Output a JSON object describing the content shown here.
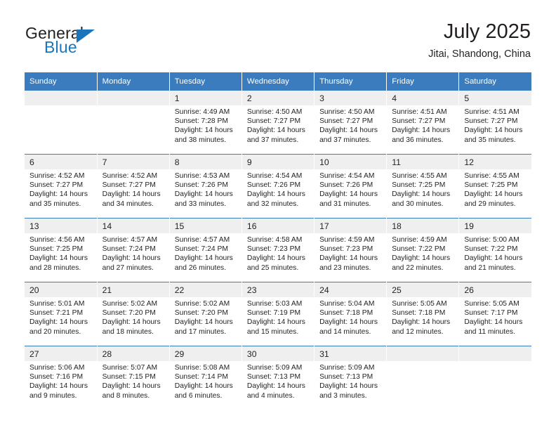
{
  "brand": {
    "logo_top": "General",
    "logo_bottom": "Blue",
    "accent_color": "#1b75bb",
    "triangle_icon": "blue-triangle-icon"
  },
  "header": {
    "title": "July 2025",
    "subtitle": "Jitai, Shandong, China"
  },
  "colors": {
    "header_row_bg": "#3a7cbe",
    "header_row_text": "#ffffff",
    "daynum_bg": "#efefef",
    "cell_bg": "#ffffff",
    "row_divider": "#3a7cbe",
    "body_text": "#231f20"
  },
  "calendar": {
    "weekday_headers": [
      "Sunday",
      "Monday",
      "Tuesday",
      "Wednesday",
      "Thursday",
      "Friday",
      "Saturday"
    ],
    "labels": {
      "sunrise_prefix": "Sunrise:",
      "sunset_prefix": "Sunset:",
      "daylight_prefix": "Daylight:"
    },
    "weeks": [
      [
        {
          "day": "",
          "lines": []
        },
        {
          "day": "",
          "lines": []
        },
        {
          "day": "1",
          "lines": [
            "Sunrise: 4:49 AM",
            "Sunset: 7:28 PM",
            "Daylight: 14 hours",
            "and 38 minutes."
          ]
        },
        {
          "day": "2",
          "lines": [
            "Sunrise: 4:50 AM",
            "Sunset: 7:27 PM",
            "Daylight: 14 hours",
            "and 37 minutes."
          ]
        },
        {
          "day": "3",
          "lines": [
            "Sunrise: 4:50 AM",
            "Sunset: 7:27 PM",
            "Daylight: 14 hours",
            "and 37 minutes."
          ]
        },
        {
          "day": "4",
          "lines": [
            "Sunrise: 4:51 AM",
            "Sunset: 7:27 PM",
            "Daylight: 14 hours",
            "and 36 minutes."
          ]
        },
        {
          "day": "5",
          "lines": [
            "Sunrise: 4:51 AM",
            "Sunset: 7:27 PM",
            "Daylight: 14 hours",
            "and 35 minutes."
          ]
        }
      ],
      [
        {
          "day": "6",
          "lines": [
            "Sunrise: 4:52 AM",
            "Sunset: 7:27 PM",
            "Daylight: 14 hours",
            "and 35 minutes."
          ]
        },
        {
          "day": "7",
          "lines": [
            "Sunrise: 4:52 AM",
            "Sunset: 7:27 PM",
            "Daylight: 14 hours",
            "and 34 minutes."
          ]
        },
        {
          "day": "8",
          "lines": [
            "Sunrise: 4:53 AM",
            "Sunset: 7:26 PM",
            "Daylight: 14 hours",
            "and 33 minutes."
          ]
        },
        {
          "day": "9",
          "lines": [
            "Sunrise: 4:54 AM",
            "Sunset: 7:26 PM",
            "Daylight: 14 hours",
            "and 32 minutes."
          ]
        },
        {
          "day": "10",
          "lines": [
            "Sunrise: 4:54 AM",
            "Sunset: 7:26 PM",
            "Daylight: 14 hours",
            "and 31 minutes."
          ]
        },
        {
          "day": "11",
          "lines": [
            "Sunrise: 4:55 AM",
            "Sunset: 7:25 PM",
            "Daylight: 14 hours",
            "and 30 minutes."
          ]
        },
        {
          "day": "12",
          "lines": [
            "Sunrise: 4:55 AM",
            "Sunset: 7:25 PM",
            "Daylight: 14 hours",
            "and 29 minutes."
          ]
        }
      ],
      [
        {
          "day": "13",
          "lines": [
            "Sunrise: 4:56 AM",
            "Sunset: 7:25 PM",
            "Daylight: 14 hours",
            "and 28 minutes."
          ]
        },
        {
          "day": "14",
          "lines": [
            "Sunrise: 4:57 AM",
            "Sunset: 7:24 PM",
            "Daylight: 14 hours",
            "and 27 minutes."
          ]
        },
        {
          "day": "15",
          "lines": [
            "Sunrise: 4:57 AM",
            "Sunset: 7:24 PM",
            "Daylight: 14 hours",
            "and 26 minutes."
          ]
        },
        {
          "day": "16",
          "lines": [
            "Sunrise: 4:58 AM",
            "Sunset: 7:23 PM",
            "Daylight: 14 hours",
            "and 25 minutes."
          ]
        },
        {
          "day": "17",
          "lines": [
            "Sunrise: 4:59 AM",
            "Sunset: 7:23 PM",
            "Daylight: 14 hours",
            "and 23 minutes."
          ]
        },
        {
          "day": "18",
          "lines": [
            "Sunrise: 4:59 AM",
            "Sunset: 7:22 PM",
            "Daylight: 14 hours",
            "and 22 minutes."
          ]
        },
        {
          "day": "19",
          "lines": [
            "Sunrise: 5:00 AM",
            "Sunset: 7:22 PM",
            "Daylight: 14 hours",
            "and 21 minutes."
          ]
        }
      ],
      [
        {
          "day": "20",
          "lines": [
            "Sunrise: 5:01 AM",
            "Sunset: 7:21 PM",
            "Daylight: 14 hours",
            "and 20 minutes."
          ]
        },
        {
          "day": "21",
          "lines": [
            "Sunrise: 5:02 AM",
            "Sunset: 7:20 PM",
            "Daylight: 14 hours",
            "and 18 minutes."
          ]
        },
        {
          "day": "22",
          "lines": [
            "Sunrise: 5:02 AM",
            "Sunset: 7:20 PM",
            "Daylight: 14 hours",
            "and 17 minutes."
          ]
        },
        {
          "day": "23",
          "lines": [
            "Sunrise: 5:03 AM",
            "Sunset: 7:19 PM",
            "Daylight: 14 hours",
            "and 15 minutes."
          ]
        },
        {
          "day": "24",
          "lines": [
            "Sunrise: 5:04 AM",
            "Sunset: 7:18 PM",
            "Daylight: 14 hours",
            "and 14 minutes."
          ]
        },
        {
          "day": "25",
          "lines": [
            "Sunrise: 5:05 AM",
            "Sunset: 7:18 PM",
            "Daylight: 14 hours",
            "and 12 minutes."
          ]
        },
        {
          "day": "26",
          "lines": [
            "Sunrise: 5:05 AM",
            "Sunset: 7:17 PM",
            "Daylight: 14 hours",
            "and 11 minutes."
          ]
        }
      ],
      [
        {
          "day": "27",
          "lines": [
            "Sunrise: 5:06 AM",
            "Sunset: 7:16 PM",
            "Daylight: 14 hours",
            "and 9 minutes."
          ]
        },
        {
          "day": "28",
          "lines": [
            "Sunrise: 5:07 AM",
            "Sunset: 7:15 PM",
            "Daylight: 14 hours",
            "and 8 minutes."
          ]
        },
        {
          "day": "29",
          "lines": [
            "Sunrise: 5:08 AM",
            "Sunset: 7:14 PM",
            "Daylight: 14 hours",
            "and 6 minutes."
          ]
        },
        {
          "day": "30",
          "lines": [
            "Sunrise: 5:09 AM",
            "Sunset: 7:13 PM",
            "Daylight: 14 hours",
            "and 4 minutes."
          ]
        },
        {
          "day": "31",
          "lines": [
            "Sunrise: 5:09 AM",
            "Sunset: 7:13 PM",
            "Daylight: 14 hours",
            "and 3 minutes."
          ]
        },
        {
          "day": "",
          "lines": []
        },
        {
          "day": "",
          "lines": []
        }
      ]
    ]
  }
}
